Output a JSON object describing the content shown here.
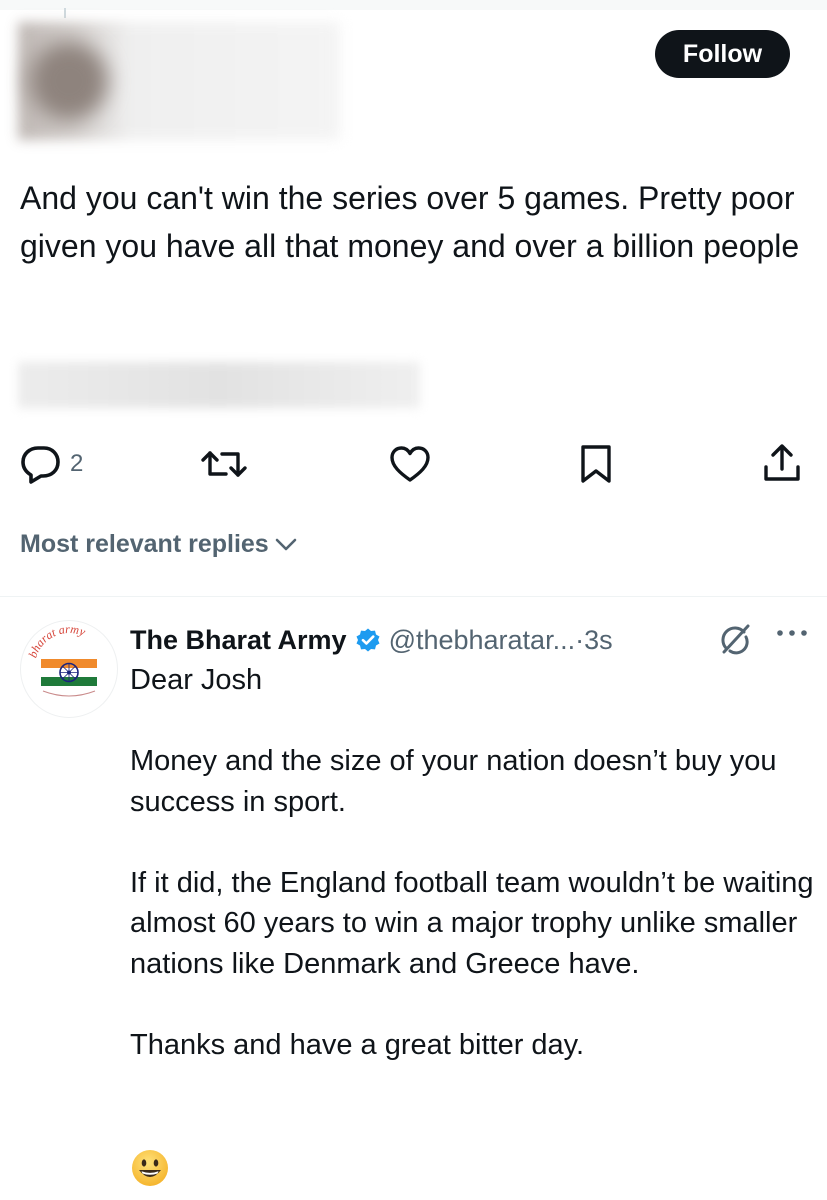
{
  "tweet": {
    "follow_label": "Follow",
    "text": "And you can't win the series over 5 games. Pretty poor given you have all that money and over a billion people",
    "actions": {
      "reply_count": "2"
    }
  },
  "replies_sort": {
    "label": "Most relevant replies"
  },
  "reply": {
    "name": "The Bharat Army",
    "handle": "@thebharatar...",
    "separator": "·",
    "time": "3s",
    "avatar_text": "bharat army",
    "body": "Dear Josh\n\nMoney and the size of your nation doesn’t buy you success in sport.\n\nIf it did, the England football team wouldn’t be waiting almost 60 years to win a major trophy unlike smaller nations like Denmark and Greece have.\n\nThanks and have a great bitter day.",
    "emoji": "😀"
  },
  "colors": {
    "text_primary": "#0f1419",
    "text_secondary": "#536471",
    "verified_blue": "#1d9bf0",
    "follow_bg": "#0f1419"
  },
  "icons": {
    "reply": "reply-icon",
    "retweet": "retweet-icon",
    "like": "heart-icon",
    "bookmark": "bookmark-icon",
    "share": "share-icon",
    "sort": "chevron-down-icon",
    "verified": "verified-badge-icon",
    "grok": "grok-icon",
    "more": "more-icon"
  }
}
